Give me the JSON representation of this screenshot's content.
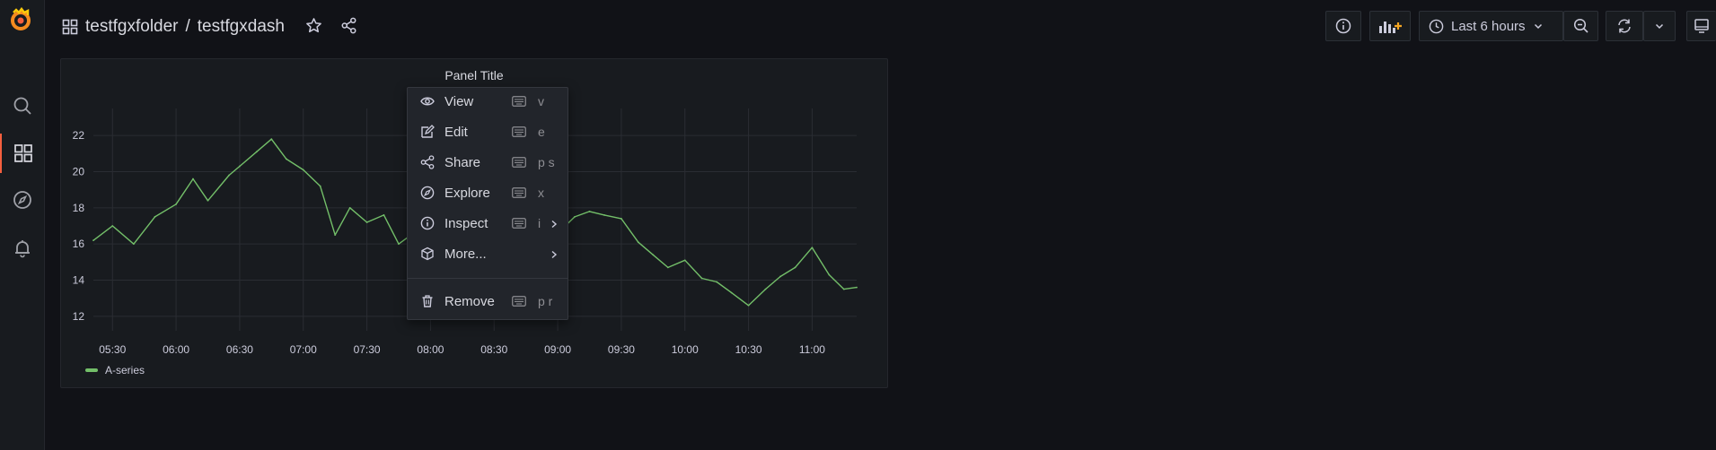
{
  "breadcrumb": {
    "folder": "testfgxfolder",
    "separator": "/",
    "dashboard": "testfgxdash"
  },
  "toolbar": {
    "time_range": "Last 6 hours"
  },
  "panel": {
    "title": "Panel Title"
  },
  "menu": {
    "items": [
      {
        "label": "View",
        "shortcut": "v",
        "icon": "eye-icon",
        "submenu": false
      },
      {
        "label": "Edit",
        "shortcut": "e",
        "icon": "edit-icon",
        "submenu": false
      },
      {
        "label": "Share",
        "shortcut": "p s",
        "icon": "share-icon",
        "submenu": false
      },
      {
        "label": "Explore",
        "shortcut": "x",
        "icon": "compass-icon",
        "submenu": false
      },
      {
        "label": "Inspect",
        "shortcut": "i",
        "icon": "info-icon",
        "submenu": true
      },
      {
        "label": "More...",
        "shortcut": "",
        "icon": "cube-icon",
        "submenu": true
      },
      {
        "label": "Remove",
        "shortcut": "p r",
        "icon": "trash-icon",
        "submenu": false
      }
    ]
  },
  "chart_data": {
    "type": "line",
    "title": "Panel Title",
    "x_tick_labels": [
      "05:30",
      "06:00",
      "06:30",
      "07:00",
      "07:30",
      "08:00",
      "08:30",
      "09:00",
      "09:30",
      "10:00",
      "10:30",
      "11:00"
    ],
    "y_ticks": [
      12,
      14,
      16,
      18,
      20,
      22
    ],
    "ylim": [
      11.2,
      23.0
    ],
    "xlim": [
      "05:21",
      "11:21"
    ],
    "grid": true,
    "legend_position": "bottom-left",
    "series": [
      {
        "name": "A-series",
        "color": "#73bf69",
        "x": [
          "05:21",
          "05:30",
          "05:40",
          "05:50",
          "06:00",
          "06:08",
          "06:15",
          "06:25",
          "06:30",
          "06:38",
          "06:45",
          "06:52",
          "07:00",
          "07:08",
          "07:15",
          "07:22",
          "07:30",
          "07:38",
          "07:45",
          "07:52",
          "08:00",
          "08:08",
          "08:15",
          "08:22",
          "08:30",
          "08:38",
          "08:45",
          "08:52",
          "09:00",
          "09:08",
          "09:15",
          "09:22",
          "09:30",
          "09:38",
          "09:45",
          "09:52",
          "10:00",
          "10:08",
          "10:15",
          "10:22",
          "10:30",
          "10:38",
          "10:45",
          "10:52",
          "11:00",
          "11:08",
          "11:15",
          "11:21"
        ],
        "y": [
          16.2,
          17.0,
          16.0,
          17.5,
          18.2,
          19.6,
          18.4,
          19.8,
          20.3,
          21.1,
          21.8,
          20.7,
          20.1,
          19.2,
          16.5,
          18.0,
          17.2,
          17.6,
          16.0,
          16.6,
          16.2,
          15.8,
          16.5,
          16.1,
          15.9,
          16.8,
          17.2,
          16.4,
          16.6,
          17.5,
          17.8,
          17.6,
          17.4,
          16.1,
          15.4,
          14.7,
          15.1,
          14.1,
          13.9,
          13.3,
          12.6,
          13.5,
          14.2,
          14.7,
          15.8,
          14.3,
          13.5,
          13.6
        ]
      }
    ]
  }
}
